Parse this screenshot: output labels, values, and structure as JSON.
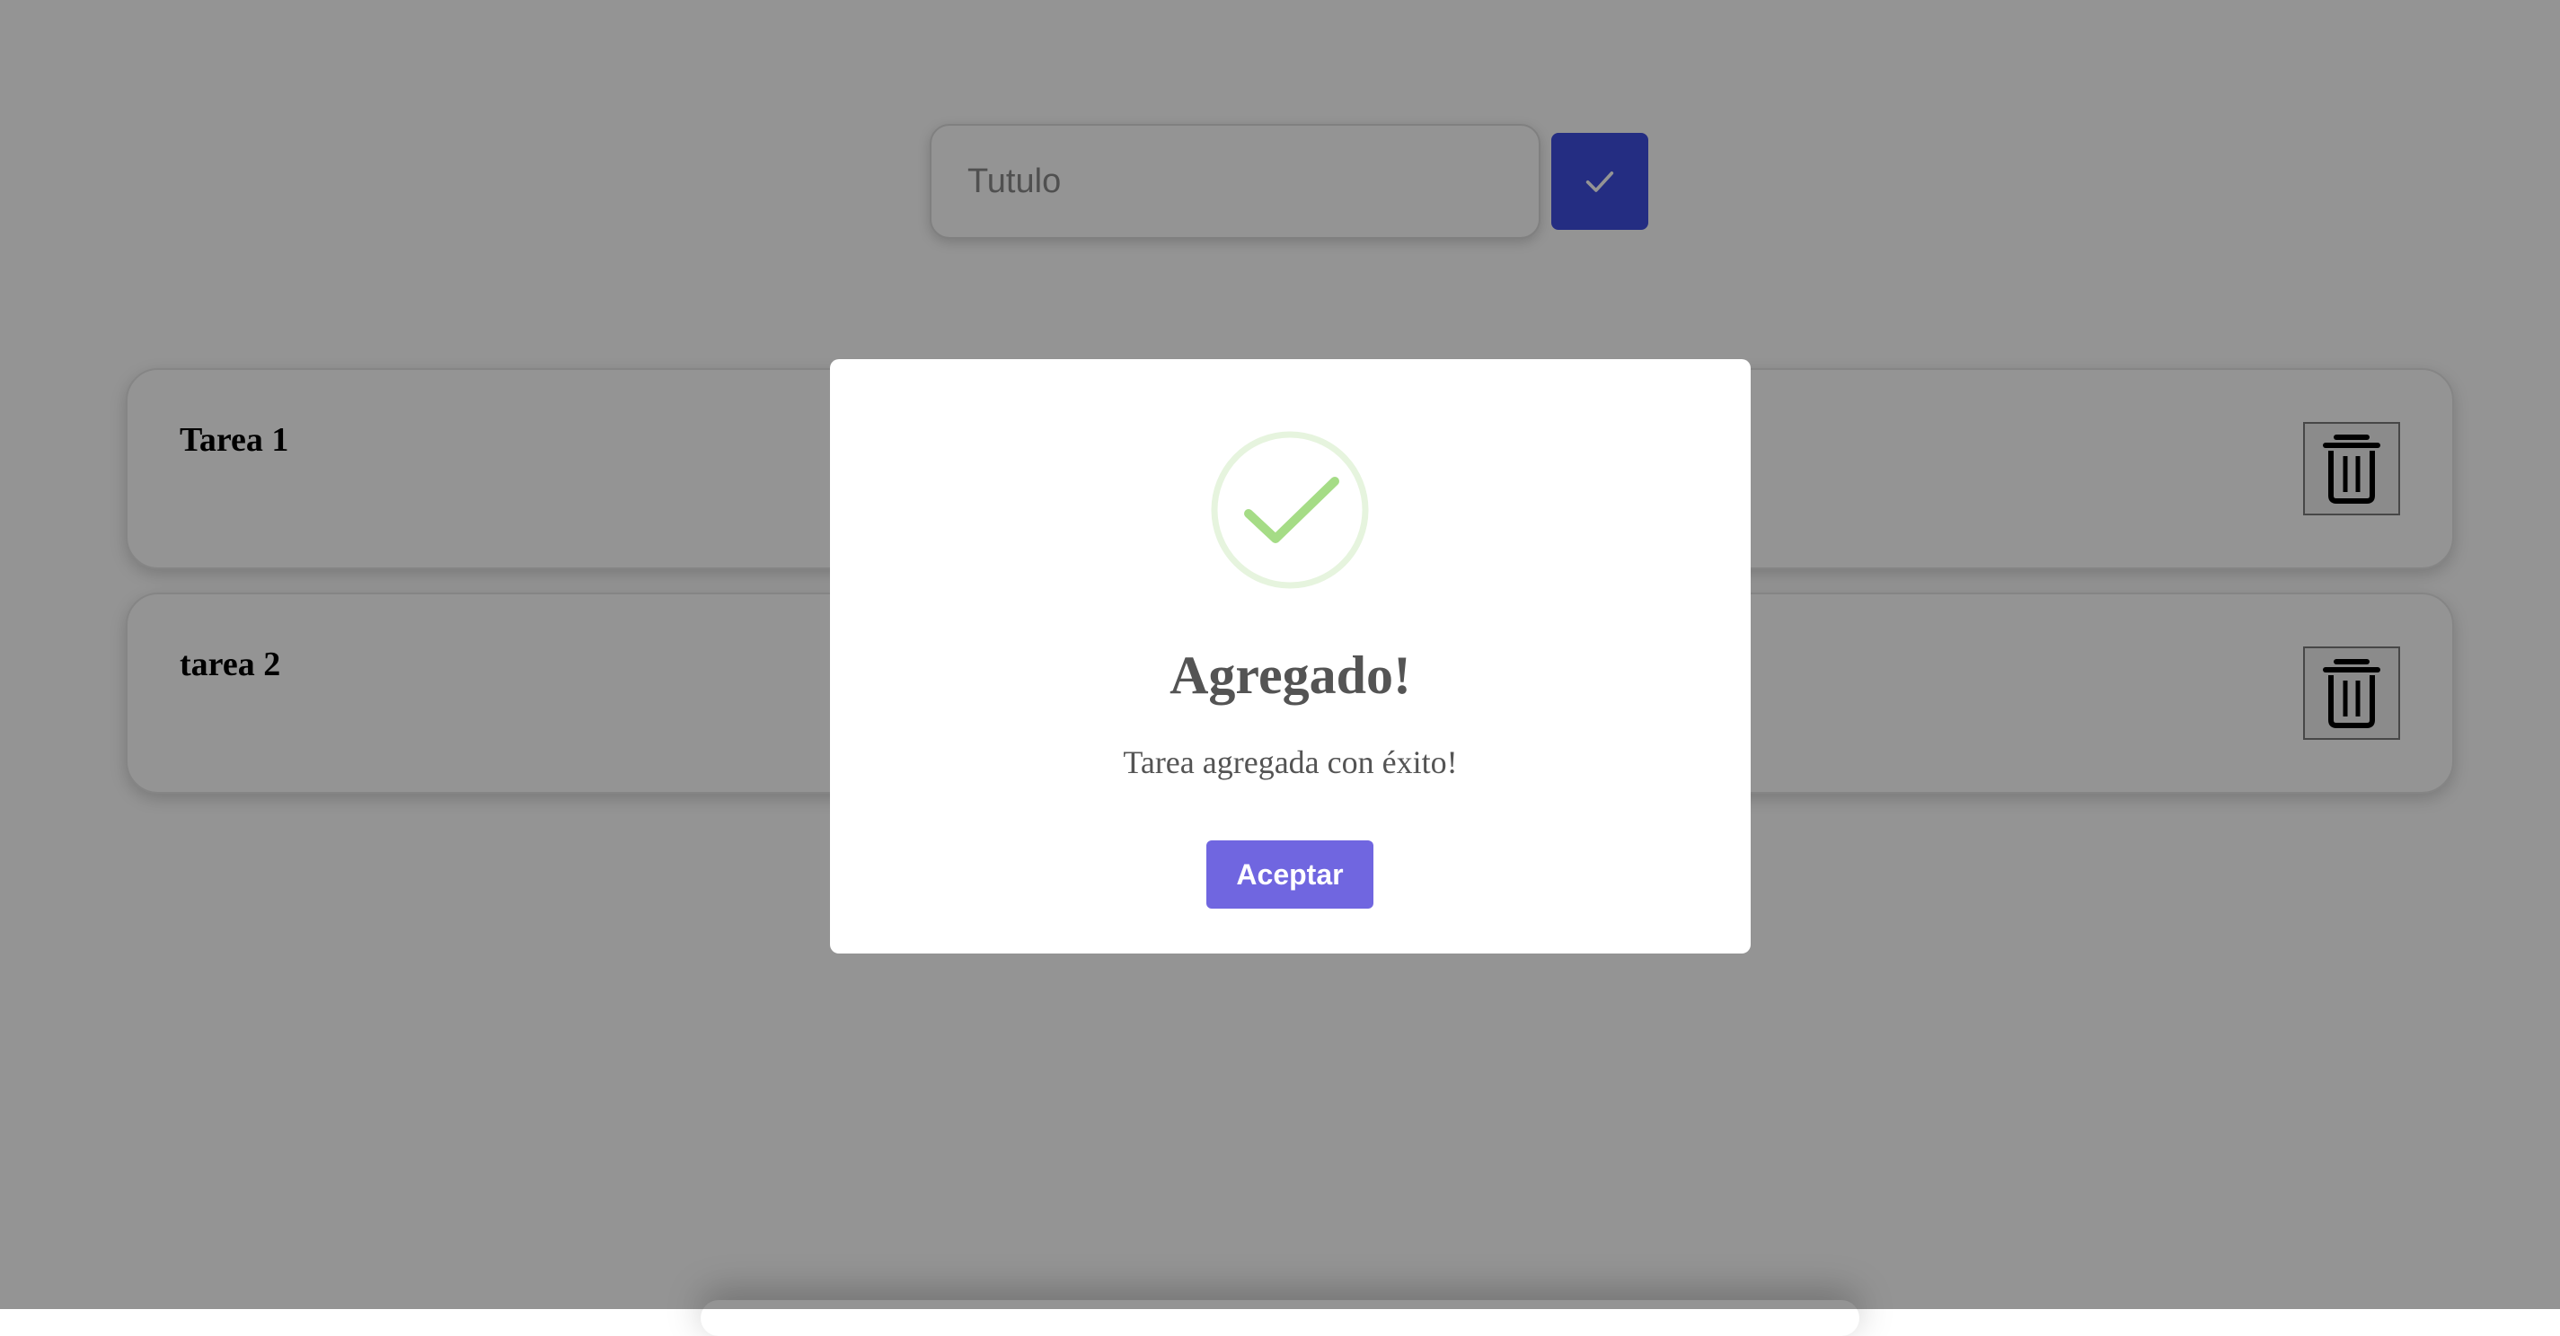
{
  "form": {
    "title_placeholder": "Tutulo",
    "title_value": "",
    "submit_icon": "check-icon"
  },
  "tasks": [
    {
      "title": "Tarea 1",
      "delete_icon": "trash-icon"
    },
    {
      "title": "tarea 2",
      "delete_icon": "trash-icon"
    }
  ],
  "dialog": {
    "icon": "success-check-icon",
    "title": "Agregado!",
    "message": "Tarea agregada con éxito!",
    "confirm_label": "Aceptar"
  },
  "colors": {
    "submit_button": "#3f4ee0",
    "confirm_button": "#7066e0",
    "success_icon": "#a5dc86",
    "overlay": "rgba(0,0,0,0.42)"
  }
}
